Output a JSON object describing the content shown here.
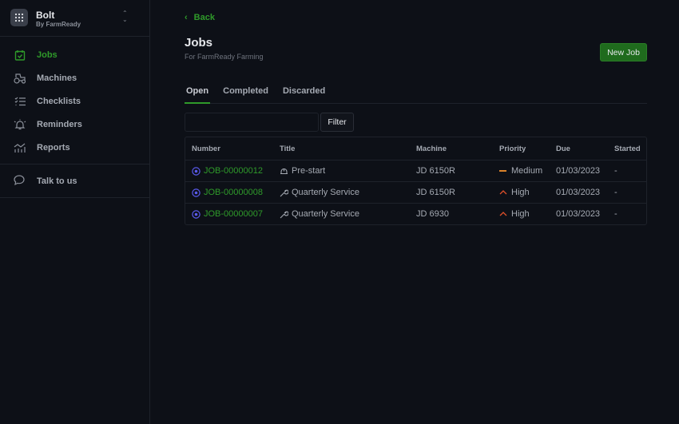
{
  "brand": {
    "name": "Bolt",
    "sub": "By FarmReady"
  },
  "nav": [
    {
      "label": "Jobs",
      "icon": "calendar-check-icon",
      "active": true
    },
    {
      "label": "Machines",
      "icon": "tractor-icon"
    },
    {
      "label": "Checklists",
      "icon": "checklist-icon"
    },
    {
      "label": "Reminders",
      "icon": "bell-icon"
    },
    {
      "label": "Reports",
      "icon": "chart-icon"
    }
  ],
  "talk": {
    "label": "Talk to us"
  },
  "header": {
    "back": "Back",
    "title": "Jobs",
    "subtitle": "For FarmReady Farming",
    "new_job": "New Job"
  },
  "tabs": [
    "Open",
    "Completed",
    "Discarded"
  ],
  "filter": {
    "value": "",
    "button": "Filter"
  },
  "table": {
    "columns": [
      "Number",
      "Title",
      "Machine",
      "Priority",
      "Due",
      "Started"
    ],
    "rows": [
      {
        "number": "JOB-00000012",
        "title": "Pre-start",
        "title_icon": "hard-hat-icon",
        "machine": "JD 6150R",
        "priority": "Medium",
        "due": "01/03/2023",
        "started": "-"
      },
      {
        "number": "JOB-00000008",
        "title": "Quarterly Service",
        "title_icon": "wrench-icon",
        "machine": "JD 6150R",
        "priority": "High",
        "due": "01/03/2023",
        "started": "-"
      },
      {
        "number": "JOB-00000007",
        "title": "Quarterly Service",
        "title_icon": "wrench-icon",
        "machine": "JD 6930",
        "priority": "High",
        "due": "01/03/2023",
        "started": "-"
      }
    ]
  },
  "colors": {
    "accent": "#2f9a2a",
    "status_open": "#5b5bf0",
    "medium": "#d9822b",
    "high": "#e0502a"
  }
}
